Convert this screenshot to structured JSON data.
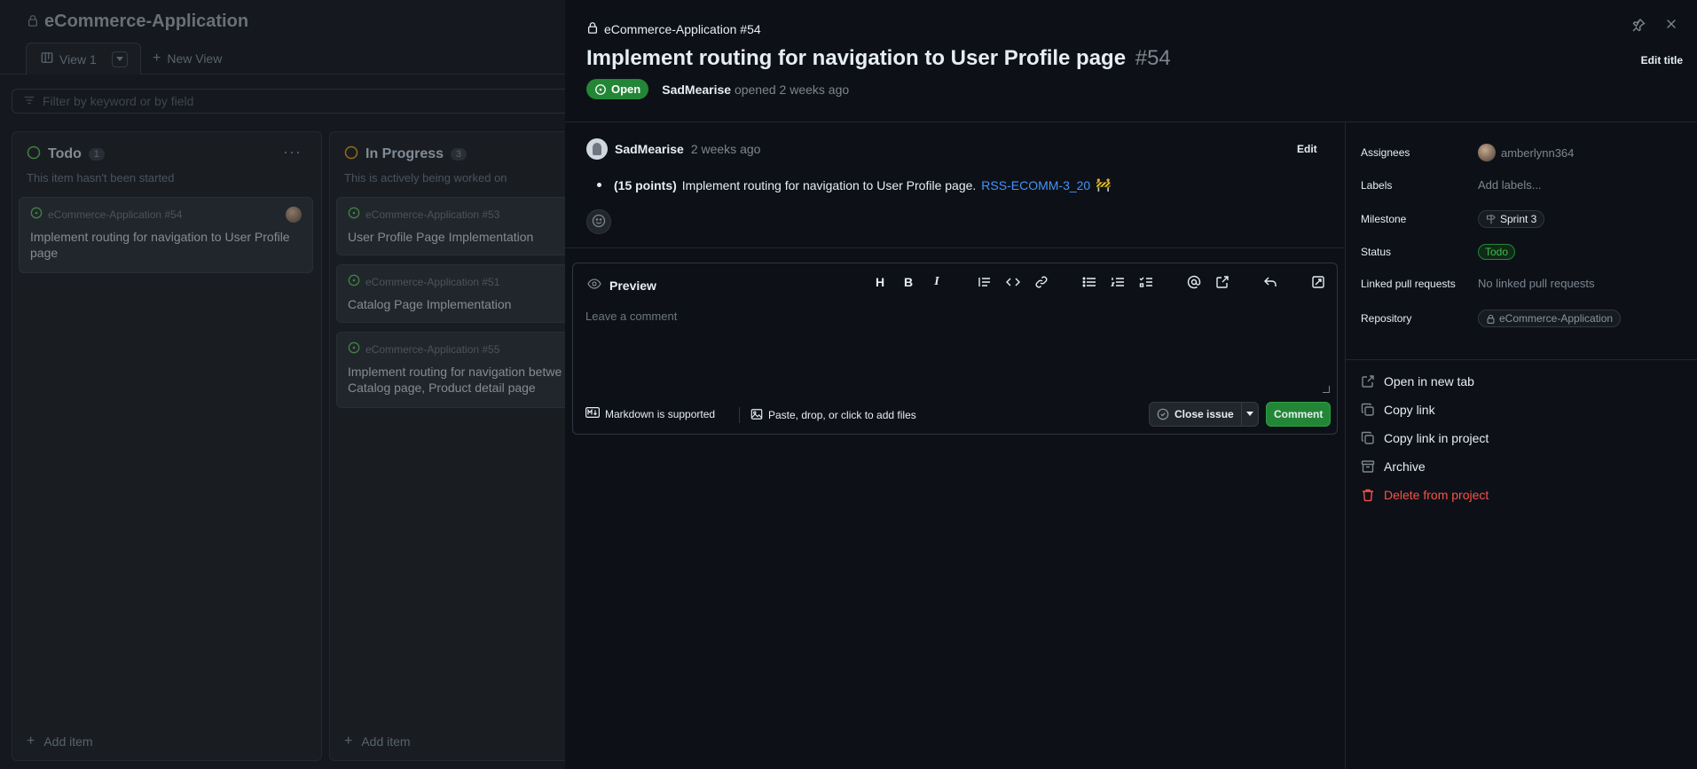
{
  "project": {
    "title": "eCommerce-Application",
    "views": [
      {
        "label": "View 1"
      }
    ],
    "new_view_label": "New View",
    "filter_placeholder": "Filter by keyword or by field"
  },
  "columns": [
    {
      "name": "Todo",
      "count": "1",
      "description": "This item hasn't been started",
      "status_color": "#57ab5a",
      "cards": [
        {
          "ref": "eCommerce-Application #54",
          "title": "Implement routing for navigation to User Profile page"
        }
      ],
      "add_item": "Add item"
    },
    {
      "name": "In Progress",
      "count": "3",
      "description": "This is actively being worked on",
      "status_color": "#c69026",
      "cards": [
        {
          "ref": "eCommerce-Application #53",
          "title": "User Profile Page Implementation"
        },
        {
          "ref": "eCommerce-Application #51",
          "title": "Catalog Page Implementation"
        },
        {
          "ref": "eCommerce-Application #55",
          "title": "Implement routing for navigation betwe",
          "title_line2": "Catalog page, Product detail page"
        }
      ],
      "add_item": "Add item"
    }
  ],
  "issue": {
    "crumb": "eCommerce-Application #54",
    "title": "Implement routing for navigation to User Profile page",
    "number": "#54",
    "edit_title": "Edit title",
    "state": "Open",
    "author": "SadMearise",
    "opened": "opened 2 weeks ago",
    "comment": {
      "author": "SadMearise",
      "time": "2 weeks ago",
      "edit": "Edit",
      "points": "(15 points)",
      "text": "Implement routing for navigation to User Profile page.",
      "link": "RSS-ECOMM-3_20",
      "emoji": "🚧"
    }
  },
  "editor": {
    "tab": "Preview",
    "placeholder": "Leave a comment",
    "markdown_note": "Markdown is supported",
    "attach_note": "Paste, drop, or click to add files",
    "close_issue": "Close issue",
    "comment_button": "Comment",
    "toolbar": {
      "heading": "H",
      "bold": "B",
      "italic": "I"
    }
  },
  "meta": {
    "assignees_label": "Assignees",
    "assignee": "amberlynn364",
    "labels_label": "Labels",
    "labels_value": "Add labels...",
    "milestone_label": "Milestone",
    "milestone": "Sprint 3",
    "status_label": "Status",
    "status": "Todo",
    "linked_label": "Linked pull requests",
    "linked_value": "No linked pull requests",
    "repository_label": "Repository",
    "repository": "eCommerce-Application"
  },
  "actions": {
    "open_new_tab": "Open in new tab",
    "copy_link": "Copy link",
    "copy_link_project": "Copy link in project",
    "archive": "Archive",
    "delete": "Delete from project"
  },
  "colors": {
    "open_green": "#238636",
    "link_blue": "#4493f8",
    "danger": "#f85149"
  }
}
